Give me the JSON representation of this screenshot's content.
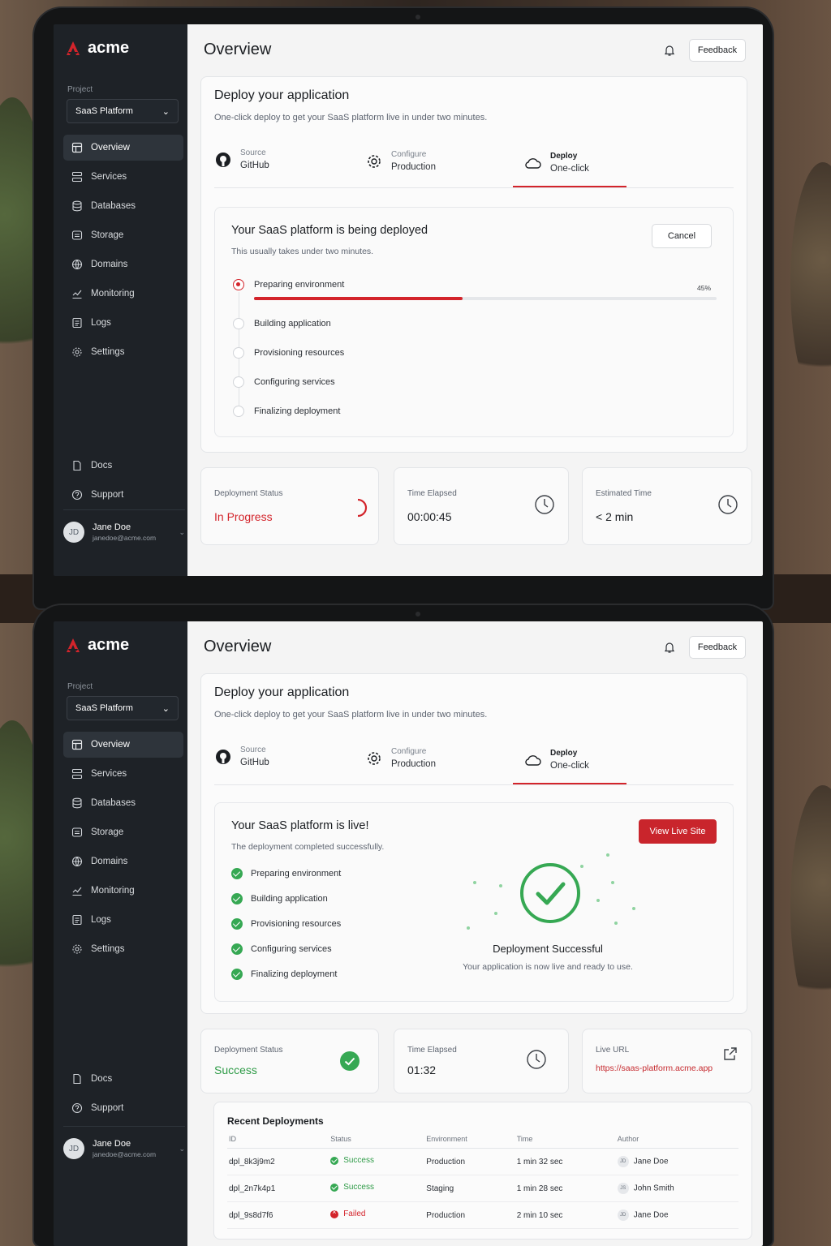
{
  "brand": {
    "name": "acme",
    "accent": "#d3242b",
    "success": "#36a853"
  },
  "sidebar": {
    "project_label": "Project",
    "project_value": "SaaS Platform",
    "items": [
      {
        "label": "Overview",
        "icon": "overview-icon"
      },
      {
        "label": "Services",
        "icon": "services-icon"
      },
      {
        "label": "Databases",
        "icon": "database-icon"
      },
      {
        "label": "Storage",
        "icon": "storage-icon"
      },
      {
        "label": "Domains",
        "icon": "globe-icon"
      },
      {
        "label": "Monitoring",
        "icon": "monitoring-icon"
      },
      {
        "label": "Logs",
        "icon": "logs-icon"
      },
      {
        "label": "Settings",
        "icon": "gear-icon"
      }
    ],
    "bottom_items": [
      {
        "label": "Docs",
        "icon": "doc-icon"
      },
      {
        "label": "Support",
        "icon": "help-icon"
      }
    ],
    "user": {
      "initials": "JD",
      "name": "Jane Doe",
      "email": "janedoe@acme.com"
    }
  },
  "header": {
    "title": "Overview",
    "feedback": "Feedback"
  },
  "deploy": {
    "title": "Deploy your application",
    "subtitle": "One-click deploy to get your SaaS platform live in under two minutes.",
    "steps": [
      {
        "label": "Source",
        "value": "GitHub"
      },
      {
        "label": "Configure",
        "value": "Production"
      },
      {
        "label": "Deploy",
        "value": "One-click"
      }
    ]
  },
  "screen1": {
    "title": "Your SaaS platform is being deployed",
    "subtitle": "This usually takes under two minutes.",
    "cancel": "Cancel",
    "progress_percent": 45,
    "progress_label": "45%",
    "tasks": [
      "Preparing environment",
      "Building application",
      "Provisioning resources",
      "Configuring services",
      "Finalizing deployment"
    ],
    "stats": {
      "status_label": "Deployment Status",
      "status_value": "In Progress",
      "elapsed_label": "Time Elapsed",
      "elapsed_value": "00:00:45",
      "estimate_label": "Estimated Time",
      "estimate_value": "< 2 min"
    }
  },
  "screen2": {
    "title": "Your SaaS platform is live!",
    "subtitle": "The deployment completed successfully.",
    "view_live": "View Live Site",
    "tasks": [
      "Preparing environment",
      "Building application",
      "Provisioning resources",
      "Configuring services",
      "Finalizing deployment"
    ],
    "success_title": "Deployment Successful",
    "success_sub": "Your application is now live and ready to use.",
    "stats": {
      "status_label": "Deployment Status",
      "status_value": "Success",
      "elapsed_label": "Time Elapsed",
      "elapsed_value": "01:32",
      "url_label": "Live URL",
      "url_value": "https://saas-platform.acme.app"
    },
    "recent": {
      "title": "Recent Deployments",
      "headers": [
        "ID",
        "Status",
        "Environment",
        "Time",
        "Author"
      ],
      "rows": [
        {
          "id": "dpl_8k3j9m2",
          "status": "Success",
          "env": "Production",
          "time": "1 min 32 sec",
          "initials": "JD",
          "author": "Jane Doe"
        },
        {
          "id": "dpl_2n7k4p1",
          "status": "Success",
          "env": "Staging",
          "time": "1 min 28 sec",
          "initials": "JS",
          "author": "John Smith"
        },
        {
          "id": "dpl_9s8d7f6",
          "status": "Failed",
          "env": "Production",
          "time": "2 min 10 sec",
          "initials": "JD",
          "author": "Jane Doe"
        }
      ]
    }
  }
}
